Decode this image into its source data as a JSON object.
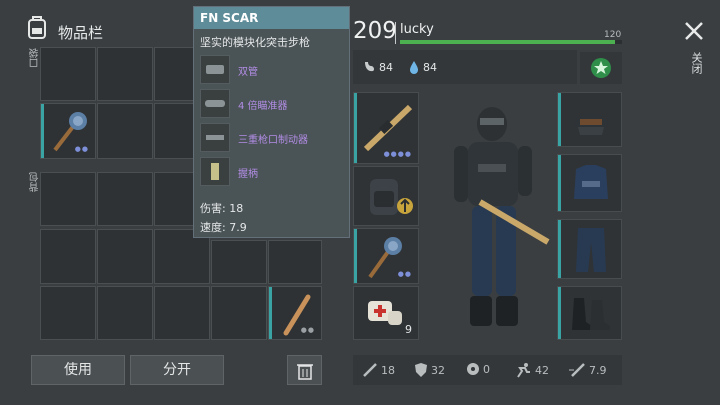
{
  "header": {
    "title": "物品栏",
    "close_label": "关闭"
  },
  "sections": {
    "pockets": "口袋",
    "backpack": "背包"
  },
  "buttons": {
    "use": "使用",
    "split": "分开"
  },
  "tooltip": {
    "name": "FN SCAR",
    "description": "坚实的模块化突击步枪",
    "mods": [
      "双管",
      "4 倍瞄准器",
      "三重枪口制动器",
      "握柄"
    ],
    "damage": "伤害: 18",
    "speed": "速度: 7.9"
  },
  "player": {
    "level": "209",
    "name": "lucky",
    "xp_max": "120",
    "xp_fraction": 0.97,
    "food": "84",
    "water": "84"
  },
  "items": {
    "bandage_count": "9"
  },
  "stats": {
    "damage": "18",
    "armor": "32",
    "radiation": "0",
    "speed": "42",
    "attack_speed": "7.9"
  },
  "colors": {
    "accent": "#4caf50",
    "tooltip_header": "#5e8c99",
    "mod_text": "#b28de5",
    "slot_bar": "#3aa3a3"
  }
}
